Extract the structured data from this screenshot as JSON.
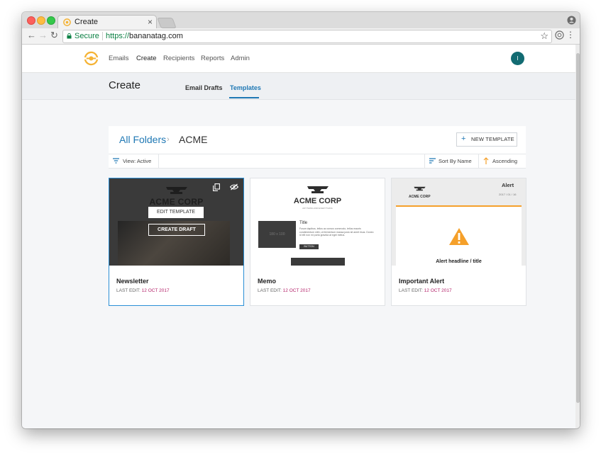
{
  "browser": {
    "tab_title": "Create",
    "secure_label": "Secure",
    "url_scheme": "https://",
    "url_host": "bananatag.com"
  },
  "header": {
    "nav": [
      "Emails",
      "Create",
      "Recipients",
      "Reports",
      "Admin"
    ],
    "active_nav": "Create",
    "avatar_initial": "I"
  },
  "subheader": {
    "title": "Create",
    "tabs": [
      "Email Drafts",
      "Templates"
    ],
    "active_tab": "Templates"
  },
  "folder": {
    "root_link": "All Folders",
    "separator": "›",
    "current": "ACME",
    "new_template_label": "NEW TEMPLATE"
  },
  "filters": {
    "view_label": "View: Active",
    "sort_label": "Sort By Name",
    "order_label": "Ascending"
  },
  "cards": [
    {
      "name": "Newsletter",
      "last_edit_label": "LAST EDIT:",
      "last_edit_date": "12 OCT 2017",
      "edit_button": "EDIT TEMPLATE",
      "draft_button": "CREATE DRAFT",
      "brand": "ACME CORP"
    },
    {
      "name": "Memo",
      "last_edit_label": "LAST EDIT:",
      "last_edit_date": "12 OCT 2017",
      "brand": "ACME CORP",
      "tagline": "ANYTHING AND EVERYTHING",
      "placeholder": "180 x 100",
      "heading": "Title",
      "body": "Fusce dapibus, tellus ac cursus commodo, tellus mauris condimentum nibh, ut fermentum massa justo sit amet risus. Donec id elit non mi porta gravida at eget metus.",
      "button": "BUTTON"
    },
    {
      "name": "Important Alert",
      "last_edit_label": "LAST EDIT:",
      "last_edit_date": "12 OCT 2017",
      "brand": "ACME CORP",
      "alert_title": "Alert",
      "alert_date": "2017 / 01 / 16",
      "alert_headline": "Alert headline / title"
    }
  ],
  "colors": {
    "accent": "#1f78b4",
    "avatar": "#126b72",
    "date": "#b4236a",
    "alert_orange": "#f5a02a",
    "logo_orange": "#f5b335"
  }
}
